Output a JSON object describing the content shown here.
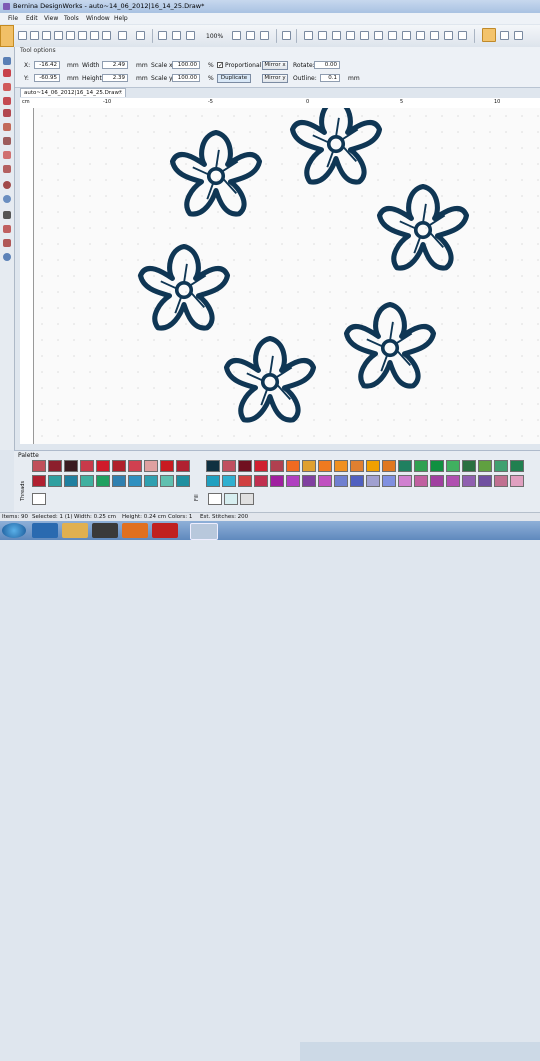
{
  "window": {
    "title": "Bernina DesignWorks - auto~14_06_2012|16_14_25.Draw*"
  },
  "menu": [
    "File",
    "Edit",
    "View",
    "Tools",
    "Window",
    "Help"
  ],
  "toolbar": {
    "zoom": "100%"
  },
  "tool_options": {
    "header": "Tool options",
    "x_label": "X:",
    "x_value": "-16.42",
    "x_unit": "mm",
    "y_label": "Y:",
    "y_value": "-60.95",
    "y_unit": "mm",
    "width_label": "Width",
    "width_value": "2.49",
    "width_unit": "mm",
    "height_label": "Height",
    "height_value": "2.39",
    "height_unit": "mm",
    "scalex_label": "Scale x",
    "scalex_value": "100.00",
    "scalex_unit": "%",
    "scaley_label": "Scale y",
    "scaley_value": "100.00",
    "scaley_unit": "%",
    "proportional_label": "Proportional",
    "duplicate_label": "Duplicate",
    "mirror_x_label": "Mirror x",
    "mirror_y_label": "Mirror y",
    "rotate_label": "Rotate:",
    "rotate_value": "0.00",
    "outline_label": "Outline:",
    "outline_value": "0.1",
    "outline_unit": "mm"
  },
  "document": {
    "tab_title": "auto~14_06_2012|16_14_25.Draw*",
    "close_glyph": "x",
    "ruler_unit": "cm",
    "ruler_ticks": [
      {
        "label": "-10"
      },
      {
        "label": "-5"
      },
      {
        "label": "0"
      },
      {
        "label": "5"
      },
      {
        "label": "10"
      }
    ]
  },
  "palette": {
    "header": "Palette",
    "threads_label": "Threads",
    "fill_label": "Fill",
    "row1_left": [
      "#c0505a",
      "#8c1f2c",
      "#3a1a20",
      "#c83a4a",
      "#d01a2a",
      "#b0202a",
      "#d04050",
      "#e0a0a0",
      "#c81a20",
      "#b02030"
    ],
    "row2_left": [
      "#b02030",
      "#30a0a0",
      "#2080a0",
      "#40b0a0",
      "#20a060",
      "#3080b0",
      "#3090c0",
      "#30a0b0",
      "#60c0b0",
      "#2090a0"
    ],
    "row1_right": [
      "#103040",
      "#c05060",
      "#701020",
      "#d02030",
      "#b04050",
      "#f06a20",
      "#e0a030",
      "#f07a20",
      "#f09020",
      "#e08030",
      "#f0a000",
      "#e07820",
      "#208060",
      "#30a050",
      "#109040",
      "#40b060",
      "#2a7040",
      "#60a040",
      "#40a070",
      "#208050"
    ],
    "row2_right": [
      "#20a0c0",
      "#30b0d0",
      "#d04040",
      "#c03050",
      "#a020a0",
      "#b040c0",
      "#8040a0",
      "#c050c0",
      "#7080d0",
      "#5060c0",
      "#a0a0d0",
      "#8090e0",
      "#d080d0",
      "#c060a0",
      "#a040a0",
      "#b050b0",
      "#9060b0",
      "#7050a0",
      "#c07090",
      "#e0a0c0"
    ]
  },
  "status": {
    "items": "Items: 90",
    "selected": "Selected: 1 (1)",
    "width": "Width: 0.25 cm",
    "height": "Height: 0.24 cm",
    "colors": "Colors: 1",
    "stitches": "Est. Stitches: 200"
  },
  "colors": {
    "outline": "#0f3654",
    "accent": "#f1c067"
  }
}
